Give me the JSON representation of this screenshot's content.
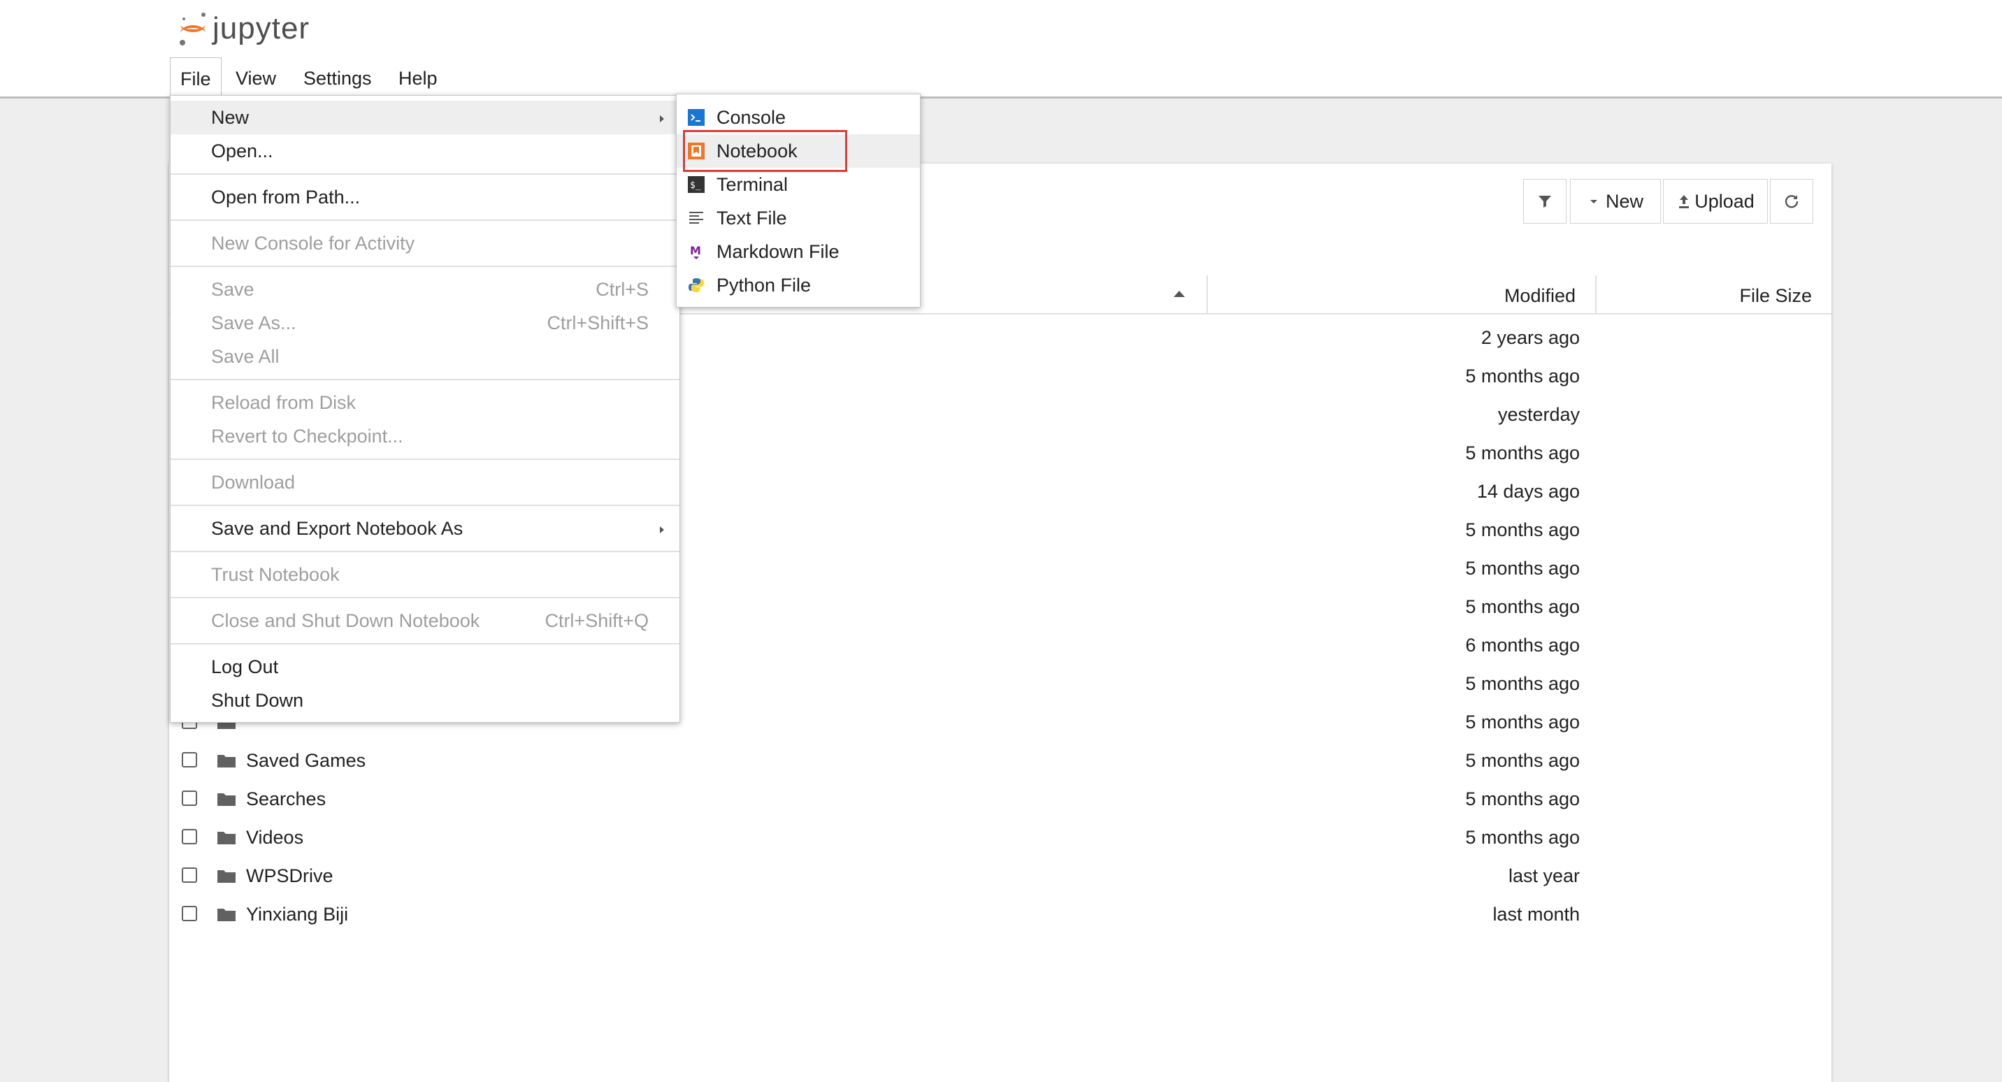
{
  "app": {
    "logo_text": "jupyter"
  },
  "menubar": {
    "items": [
      "File",
      "View",
      "Settings",
      "Help"
    ]
  },
  "toolbar": {
    "new_label": "New",
    "upload_label": "Upload"
  },
  "table": {
    "headers": {
      "modified": "Modified",
      "size": "File Size"
    },
    "rows": [
      {
        "name": "",
        "modified": "2 years ago"
      },
      {
        "name": "",
        "modified": "5 months ago"
      },
      {
        "name": "",
        "modified": "yesterday"
      },
      {
        "name": "",
        "modified": "5 months ago"
      },
      {
        "name": "",
        "modified": "14 days ago"
      },
      {
        "name": "",
        "modified": "5 months ago"
      },
      {
        "name": "",
        "modified": "5 months ago"
      },
      {
        "name": "",
        "modified": "5 months ago"
      },
      {
        "name": "",
        "modified": "6 months ago"
      },
      {
        "name": "",
        "modified": "5 months ago"
      },
      {
        "name": "",
        "modified": "5 months ago"
      },
      {
        "name": "Saved Games",
        "modified": "5 months ago"
      },
      {
        "name": "Searches",
        "modified": "5 months ago"
      },
      {
        "name": "Videos",
        "modified": "5 months ago"
      },
      {
        "name": "WPSDrive",
        "modified": "last year"
      },
      {
        "name": "Yinxiang Biji",
        "modified": "last month"
      }
    ]
  },
  "file_menu": {
    "new": "New",
    "open": "Open...",
    "open_from_path": "Open from Path...",
    "new_console": "New Console for Activity",
    "save": "Save",
    "save_sc": "Ctrl+S",
    "save_as": "Save As...",
    "save_as_sc": "Ctrl+Shift+S",
    "save_all": "Save All",
    "reload": "Reload from Disk",
    "revert": "Revert to Checkpoint...",
    "download": "Download",
    "export": "Save and Export Notebook As",
    "trust": "Trust Notebook",
    "close_shutdown": "Close and Shut Down Notebook",
    "close_shutdown_sc": "Ctrl+Shift+Q",
    "logout": "Log Out",
    "shutdown": "Shut Down"
  },
  "new_submenu": {
    "items": [
      "Console",
      "Notebook",
      "Terminal",
      "Text File",
      "Markdown File",
      "Python File"
    ]
  },
  "colors": {
    "accent_orange": "#f37626",
    "highlight_red": "#e53935",
    "console_blue": "#1976d2"
  }
}
